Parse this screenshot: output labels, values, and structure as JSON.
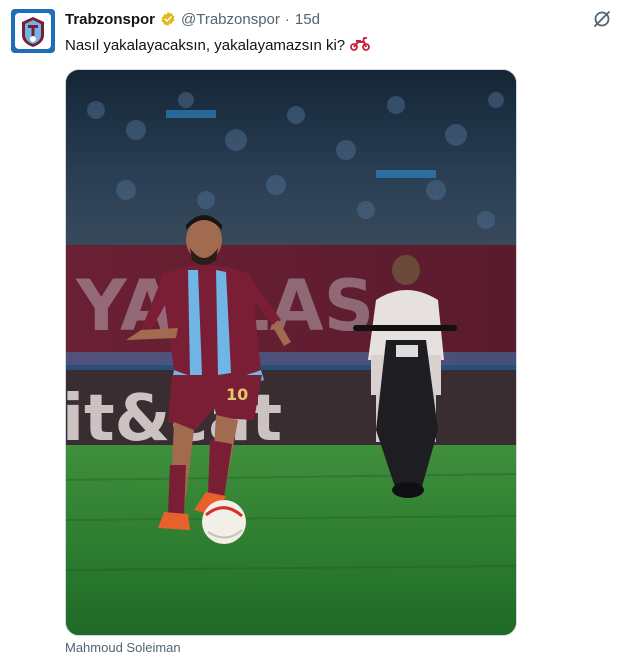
{
  "tweet": {
    "display_name": "Trabzonspor",
    "handle": "@Trabzonspor",
    "separator": "·",
    "time": "15d",
    "text": "Nasıl yakalayacaksın, yakalayamazsın ki?",
    "emoji": "motor-scooter-icon",
    "media_alt": "Trabzonspor player dribbling ball on pitch while an opposing player rides a scooter behind him",
    "caption_partial": "Mahmoud Soleiman"
  },
  "colors": {
    "club_maroon": "#7a1e36",
    "club_blue": "#6fb5e6",
    "verified_gold": "#e2b719",
    "muted_text": "#536471",
    "pitch_green": "#2f8a3a"
  }
}
